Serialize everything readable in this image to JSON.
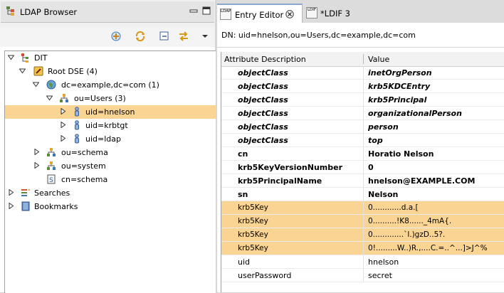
{
  "left_view": {
    "title": "LDAP Browser",
    "tree": [
      {
        "label": "DIT"
      },
      {
        "label": "Root DSE (4)"
      },
      {
        "label": "dc=example,dc=com (1)"
      },
      {
        "label": "ou=Users (3)"
      },
      {
        "label": "uid=hnelson",
        "selected": true
      },
      {
        "label": "uid=krbtgt"
      },
      {
        "label": "uid=ldap"
      },
      {
        "label": "ou=schema"
      },
      {
        "label": "ou=system"
      },
      {
        "label": "cn=schema"
      },
      {
        "label": "Searches"
      },
      {
        "label": "Bookmarks"
      }
    ]
  },
  "editor": {
    "tabs": [
      {
        "label": "Entry Editor",
        "active": true
      },
      {
        "label": "*LDIF 3",
        "active": false
      }
    ],
    "tab_icons": {
      "entry": "LDAP",
      "ldif": "LDIF"
    },
    "dn": "DN: uid=hnelson,ou=Users,dc=example,dc=com",
    "columns": [
      "Attribute Description",
      "Value"
    ],
    "rows": [
      {
        "attr": "objectClass",
        "value": "inetOrgPerson",
        "kind": "objectclass"
      },
      {
        "attr": "objectClass",
        "value": "krb5KDCEntry",
        "kind": "objectclass"
      },
      {
        "attr": "objectClass",
        "value": "krb5Principal",
        "kind": "objectclass"
      },
      {
        "attr": "objectClass",
        "value": "organizationalPerson",
        "kind": "objectclass"
      },
      {
        "attr": "objectClass",
        "value": "person",
        "kind": "objectclass"
      },
      {
        "attr": "objectClass",
        "value": "top",
        "kind": "objectclass"
      },
      {
        "attr": "cn",
        "value": "Horatio Nelson",
        "kind": "must"
      },
      {
        "attr": "krb5KeyVersionNumber",
        "value": "0",
        "kind": "must"
      },
      {
        "attr": "krb5PrincipalName",
        "value": "hnelson@EXAMPLE.COM",
        "kind": "must"
      },
      {
        "attr": "sn",
        "value": "Nelson",
        "kind": "must"
      },
      {
        "attr": "krb5Key",
        "value": "0............d.a.[",
        "kind": "binary"
      },
      {
        "attr": "krb5Key",
        "value": "0..........!K8......_4mA{.",
        "kind": "binary"
      },
      {
        "attr": "krb5Key",
        "value": "0.............`l.)gzD..5?.",
        "kind": "binary"
      },
      {
        "attr": "krb5Key",
        "value": "0!.........W..)R.,....C.=..^...]>J^%",
        "kind": "binary"
      },
      {
        "attr": "uid",
        "value": "hnelson",
        "kind": "may"
      },
      {
        "attr": "userPassword",
        "value": "secret",
        "kind": "may"
      }
    ]
  },
  "colors": {
    "selection": "#f9d493",
    "tab_accent": "#8aa7d0"
  }
}
